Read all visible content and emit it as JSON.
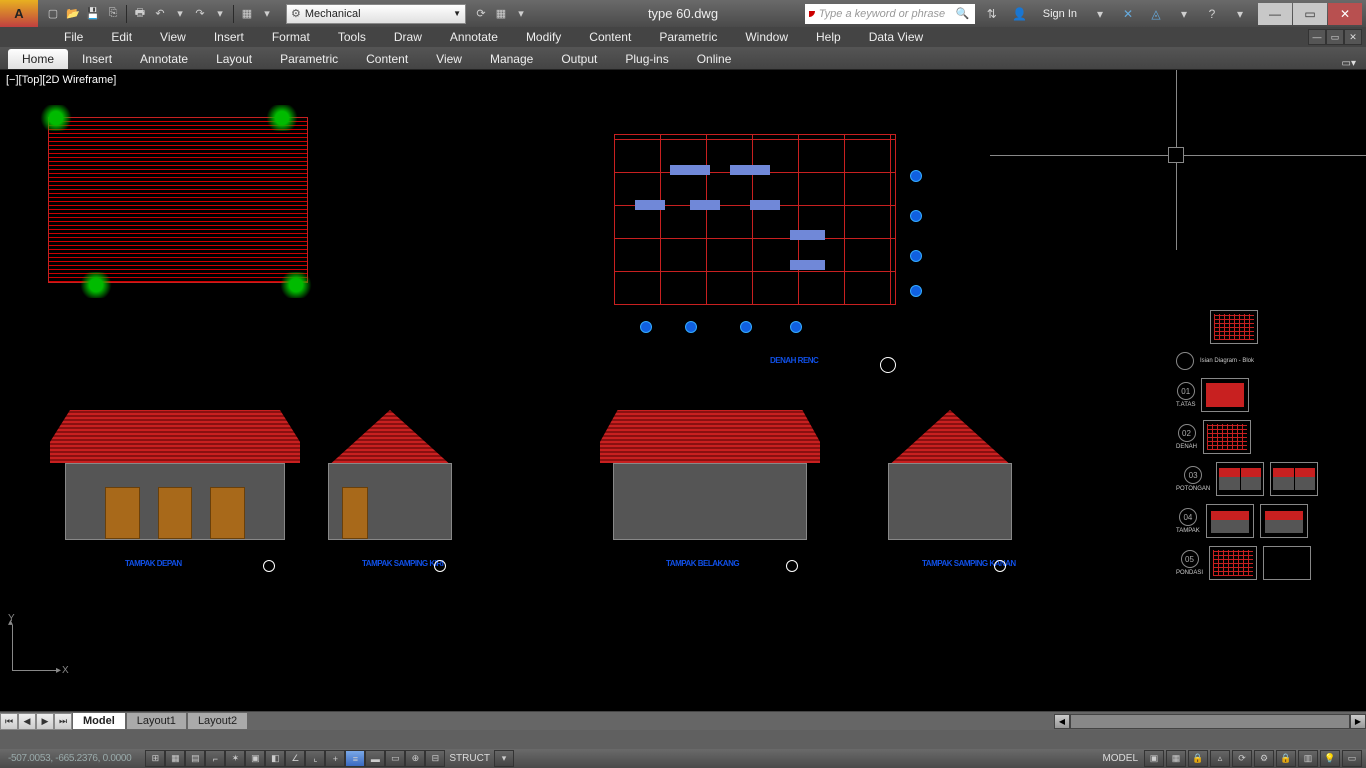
{
  "title": {
    "app_initial": "A",
    "doc": "type 60.dwg"
  },
  "qat": {
    "workspace": "Mechanical",
    "search_placeholder": "Type a keyword or phrase",
    "signin": "Sign In"
  },
  "menubar": [
    "File",
    "Edit",
    "View",
    "Insert",
    "Format",
    "Tools",
    "Draw",
    "Annotate",
    "Modify",
    "Content",
    "Parametric",
    "Window",
    "Help",
    "Data View"
  ],
  "ribtabs": [
    "Home",
    "Insert",
    "Annotate",
    "Layout",
    "Parametric",
    "Content",
    "View",
    "Manage",
    "Output",
    "Plug-ins",
    "Online"
  ],
  "ribtab_active": 0,
  "viewport_label": "[−][Top][2D Wireframe]",
  "floorplan_label": "DENAH RENC",
  "elev_labels": {
    "front": "TAMPAK DEPAN",
    "left": "TAMPAK SAMPING KIRI",
    "back": "TAMPAK BELAKANG",
    "right": "TAMPAK SAMPING KANAN"
  },
  "ucs": {
    "x": "X",
    "y": "Y"
  },
  "thumbs": {
    "legend": "Isian Diagram - Blok",
    "items": [
      {
        "num": "01",
        "lbl": "T.ATAS"
      },
      {
        "num": "02",
        "lbl": "DENAH"
      },
      {
        "num": "03",
        "lbl": "POTONGAN"
      },
      {
        "num": "04",
        "lbl": "TAMPAK"
      },
      {
        "num": "05",
        "lbl": "PONDASI"
      }
    ]
  },
  "layout_tabs": [
    "Model",
    "Layout1",
    "Layout2"
  ],
  "layout_active": 0,
  "status": {
    "coords": "-507.0053, -665.2376, 0.0000",
    "struct": "STRUCT",
    "model": "MODEL"
  }
}
